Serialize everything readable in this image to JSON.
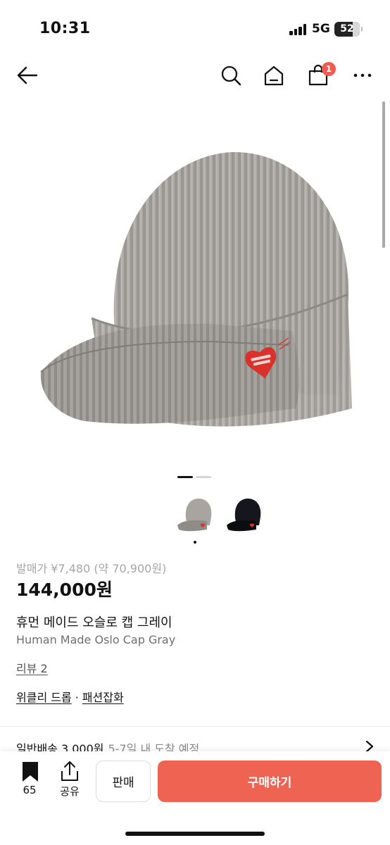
{
  "status_bar": {
    "time": "10:31",
    "network": "5G",
    "battery": "52"
  },
  "nav": {
    "icons": [
      "back-arrow-icon",
      "search-icon",
      "home-icon",
      "shopping-bag-icon",
      "more-icon"
    ],
    "cart_badge": "1"
  },
  "gallery": {
    "total_images": 2,
    "current_index": 1,
    "thumbnails": [
      "gray-cap-thumbnail",
      "black-cap-thumbnail"
    ]
  },
  "product": {
    "original_price": "발매가 ¥7,480 (약 70,900원)",
    "price": "144,000원",
    "name_ko": "휴먼 메이드 오슬로 캡 그레이",
    "name_en": "Human Made Oslo Cap Gray",
    "reviews": "리뷰 2",
    "tags": [
      "위클리 드롭",
      "패션잡화"
    ],
    "tag_separator": "·"
  },
  "shipping": {
    "label": "일반배송 3,000원",
    "note": "5-7일 내 도착 예정"
  },
  "bottom_bar": {
    "bookmark_count": "65",
    "share_label": "공유",
    "sell_label": "판매",
    "buy_label": "구매하기"
  },
  "colors": {
    "accent": "#ef6353",
    "badge": "#ef5b4f"
  }
}
